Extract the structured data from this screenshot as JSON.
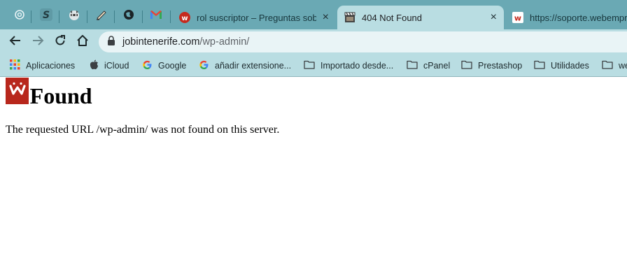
{
  "tabs": {
    "pinned": [
      {
        "name": "openai-icon"
      },
      {
        "name": "s-logo-icon"
      },
      {
        "name": "raccoon-icon"
      },
      {
        "name": "pen-hand-icon"
      },
      {
        "name": "globe-icon"
      },
      {
        "name": "gmail-icon"
      }
    ],
    "items": [
      {
        "title": "rol suscriptor – Preguntas sobre",
        "icon": "webempresa-icon",
        "active": false
      },
      {
        "title": "404 Not Found",
        "icon": "film-icon",
        "active": true
      },
      {
        "title": "https://soporte.webempresa",
        "icon": "webempresa-icon",
        "active": false
      }
    ]
  },
  "toolbar": {
    "url_host": "jobintenerife.com",
    "url_path": "/wp-admin/"
  },
  "bookmarks": [
    {
      "label": "Aplicaciones",
      "icon": "apps-grid-icon"
    },
    {
      "label": "iCloud",
      "icon": "apple-icon"
    },
    {
      "label": "Google",
      "icon": "google-icon"
    },
    {
      "label": "añadir extensione...",
      "icon": "google-icon"
    },
    {
      "label": "Importado desde...",
      "icon": "folder-icon"
    },
    {
      "label": "cPanel",
      "icon": "folder-icon"
    },
    {
      "label": "Prestashop",
      "icon": "folder-icon"
    },
    {
      "label": "Utilidades",
      "icon": "folder-icon"
    },
    {
      "label": "we",
      "icon": "folder-icon"
    }
  ],
  "page": {
    "heading": "ot Found",
    "message": "The requested URL /wp-admin/ was not found on this server."
  },
  "colors": {
    "tabstrip": "#6aa9b4",
    "toolbar": "#b9dde2",
    "omnibox": "#e9f4f6",
    "brand_red": "#b8271c"
  }
}
